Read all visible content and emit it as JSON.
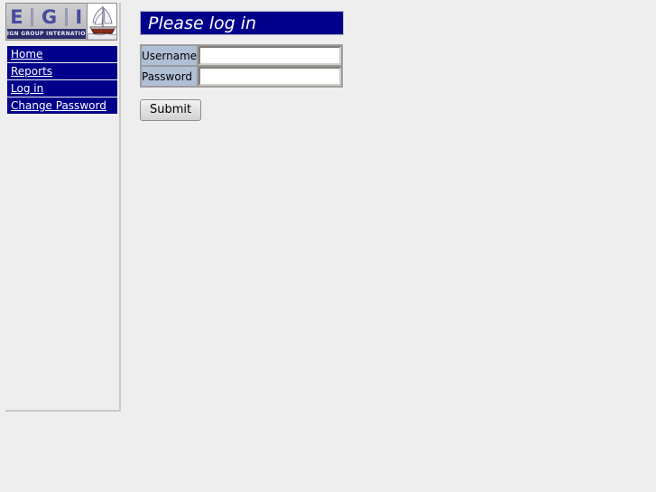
{
  "page": {
    "background_color": "#eeeeee"
  },
  "sidebar": {
    "logo": {
      "letters": [
        "E",
        "G",
        "I"
      ],
      "tagline": "ENSIGN GROUP INTERNATIONAL",
      "ship_icon_name": "sailing-ship-icon",
      "letter_color": "#4a4a9e",
      "tagline_bg_color": "#2b2b6b"
    },
    "nav": {
      "background_color": "#00008b",
      "items": [
        {
          "label": "Home"
        },
        {
          "label": "Reports"
        },
        {
          "label": "Log in"
        },
        {
          "label": "Change Password"
        }
      ]
    }
  },
  "main": {
    "banner": {
      "title": "Please log in",
      "background_color": "#00008b",
      "text_color": "#ffffff"
    },
    "form": {
      "label_cell_color": "#b0c0d4",
      "fields": [
        {
          "label": "Username",
          "value": "",
          "placeholder": "",
          "type": "text"
        },
        {
          "label": "Password",
          "value": "",
          "placeholder": "",
          "type": "password"
        }
      ],
      "submit_label": "Submit"
    }
  }
}
